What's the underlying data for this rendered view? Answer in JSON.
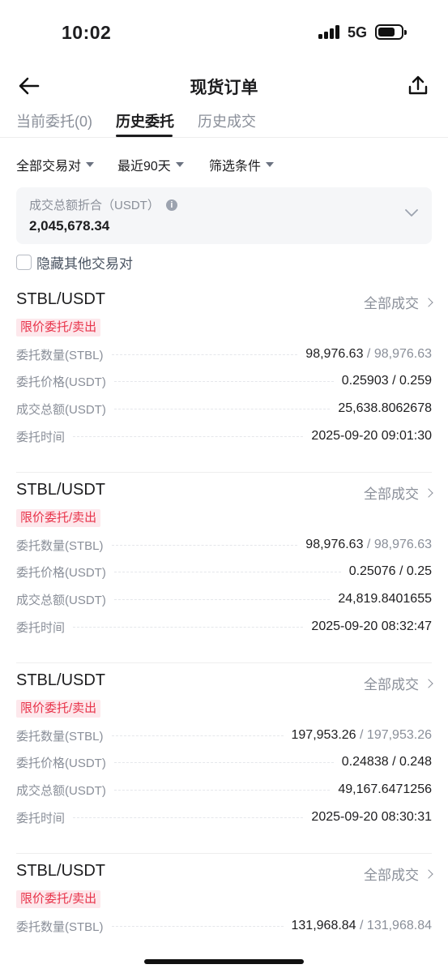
{
  "status_bar": {
    "time": "10:02",
    "network": "5G"
  },
  "nav": {
    "title": "现货订单"
  },
  "tabs": [
    {
      "label": "当前委托(0)",
      "active": false
    },
    {
      "label": "历史委托",
      "active": true
    },
    {
      "label": "历史成交",
      "active": false
    }
  ],
  "filters": {
    "pair": "全部交易对",
    "period": "最近90天",
    "conditions": "筛选条件"
  },
  "summary": {
    "label": "成交总额折合（USDT）",
    "value": "2,045,678.34"
  },
  "hide_other": {
    "label": "隐藏其他交易对",
    "checked": false
  },
  "orders": [
    {
      "pair": "STBL/USDT",
      "status": "全部成交",
      "badge": "限价委托/卖出",
      "qty_label": "委托数量(STBL)",
      "qty_filled": "98,976.63",
      "qty_total": " / 98,976.63",
      "price_label": "委托价格(USDT)",
      "price": "0.25903 / 0.259",
      "amount_label": "成交总额(USDT)",
      "amount": "25,638.8062678",
      "time_label": "委托时间",
      "time": "2025-09-20 09:01:30"
    },
    {
      "pair": "STBL/USDT",
      "status": "全部成交",
      "badge": "限价委托/卖出",
      "qty_label": "委托数量(STBL)",
      "qty_filled": "98,976.63",
      "qty_total": " / 98,976.63",
      "price_label": "委托价格(USDT)",
      "price": "0.25076 / 0.25",
      "amount_label": "成交总额(USDT)",
      "amount": "24,819.8401655",
      "time_label": "委托时间",
      "time": "2025-09-20 08:32:47"
    },
    {
      "pair": "STBL/USDT",
      "status": "全部成交",
      "badge": "限价委托/卖出",
      "qty_label": "委托数量(STBL)",
      "qty_filled": "197,953.26",
      "qty_total": " / 197,953.26",
      "price_label": "委托价格(USDT)",
      "price": "0.24838 / 0.248",
      "amount_label": "成交总额(USDT)",
      "amount": "49,167.6471256",
      "time_label": "委托时间",
      "time": "2025-09-20 08:30:31"
    },
    {
      "pair": "STBL/USDT",
      "status": "全部成交",
      "badge": "限价委托/卖出",
      "qty_label": "委托数量(STBL)",
      "qty_filled": "131,968.84",
      "qty_total": " / 131,968.84"
    }
  ],
  "colors": {
    "sell_red": "#e8334a",
    "sell_bg": "#fde8ec",
    "muted": "#8a8f99"
  }
}
